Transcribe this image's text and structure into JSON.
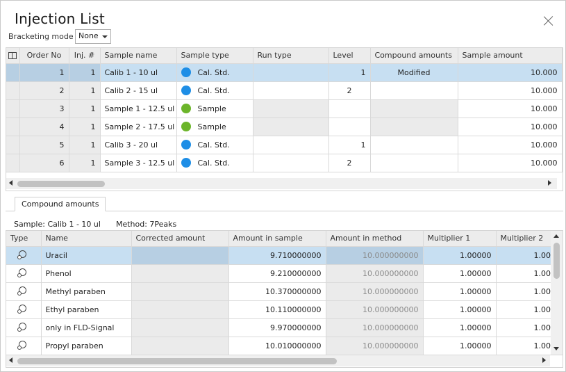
{
  "window": {
    "title": "Injection List"
  },
  "bracketing": {
    "label": "Bracketing mode",
    "value": "None"
  },
  "injection_table": {
    "columns": [
      "Order No",
      "Inj. #",
      "Sample name",
      "Sample type",
      "Run type",
      "Level",
      "Compound amounts",
      "Sample amount"
    ],
    "rows": [
      {
        "order": "1",
        "inj": "1",
        "name": "Calib 1 - 10 ul",
        "type": "Cal. Std.",
        "type_color": "#1e8ee6",
        "run": "",
        "level": "1",
        "compound": "Modified",
        "amount": "10.000"
      },
      {
        "order": "2",
        "inj": "1",
        "name": "Calib 2 - 15 ul",
        "type": "Cal. Std.",
        "type_color": "#1e8ee6",
        "run": "",
        "level": "2",
        "compound": "",
        "amount": "10.000"
      },
      {
        "order": "3",
        "inj": "1",
        "name": "Sample 1 - 12.5 ul",
        "type": "Sample",
        "type_color": "#6cb52a",
        "run": "",
        "level": "",
        "compound": "",
        "amount": "10.000"
      },
      {
        "order": "4",
        "inj": "1",
        "name": "Sample 2 - 17.5 ul",
        "type": "Sample",
        "type_color": "#6cb52a",
        "run": "",
        "level": "",
        "compound": "",
        "amount": "10.000"
      },
      {
        "order": "5",
        "inj": "1",
        "name": "Calib 3 - 20 ul",
        "type": "Cal. Std.",
        "type_color": "#1e8ee6",
        "run": "",
        "level": "1",
        "compound": "",
        "amount": "10.000"
      },
      {
        "order": "6",
        "inj": "1",
        "name": "Sample 3 - 12.5 ul",
        "type": "Cal. Std.",
        "type_color": "#1e8ee6",
        "run": "",
        "level": "2",
        "compound": "",
        "amount": "10.000"
      }
    ]
  },
  "tabs": [
    {
      "label": "Compound amounts"
    }
  ],
  "compound_info": {
    "sample": "Sample: Calib 1 - 10 ul",
    "method": "Method: 7Peaks"
  },
  "compound_table": {
    "columns": [
      "Type",
      "Name",
      "Corrected amount",
      "Amount in sample",
      "Amount in method",
      "Multiplier 1",
      "Multiplier 2"
    ],
    "rows": [
      {
        "name": "Uracil",
        "corrected": "",
        "in_sample": "9.710000000",
        "in_method": "10.000000000",
        "m1": "1.00000",
        "m2": "1.00"
      },
      {
        "name": "Phenol",
        "corrected": "",
        "in_sample": "9.210000000",
        "in_method": "10.000000000",
        "m1": "1.00000",
        "m2": "1.00"
      },
      {
        "name": "Methyl paraben",
        "corrected": "",
        "in_sample": "10.370000000",
        "in_method": "10.000000000",
        "m1": "1.00000",
        "m2": "1.00"
      },
      {
        "name": "Ethyl paraben",
        "corrected": "",
        "in_sample": "10.110000000",
        "in_method": "10.000000000",
        "m1": "1.00000",
        "m2": "1.00"
      },
      {
        "name": "only in FLD-Signal",
        "corrected": "",
        "in_sample": "9.970000000",
        "in_method": "10.000000000",
        "m1": "1.00000",
        "m2": "1.00"
      },
      {
        "name": "Propyl paraben",
        "corrected": "",
        "in_sample": "10.010000000",
        "in_method": "10.000000000",
        "m1": "1.00000",
        "m2": "1.00"
      }
    ]
  },
  "icons": {
    "close": "close-icon",
    "column-chooser": "column-chooser-icon",
    "compound-type": "compound-icon",
    "dropdown": "chevron-down-icon"
  }
}
